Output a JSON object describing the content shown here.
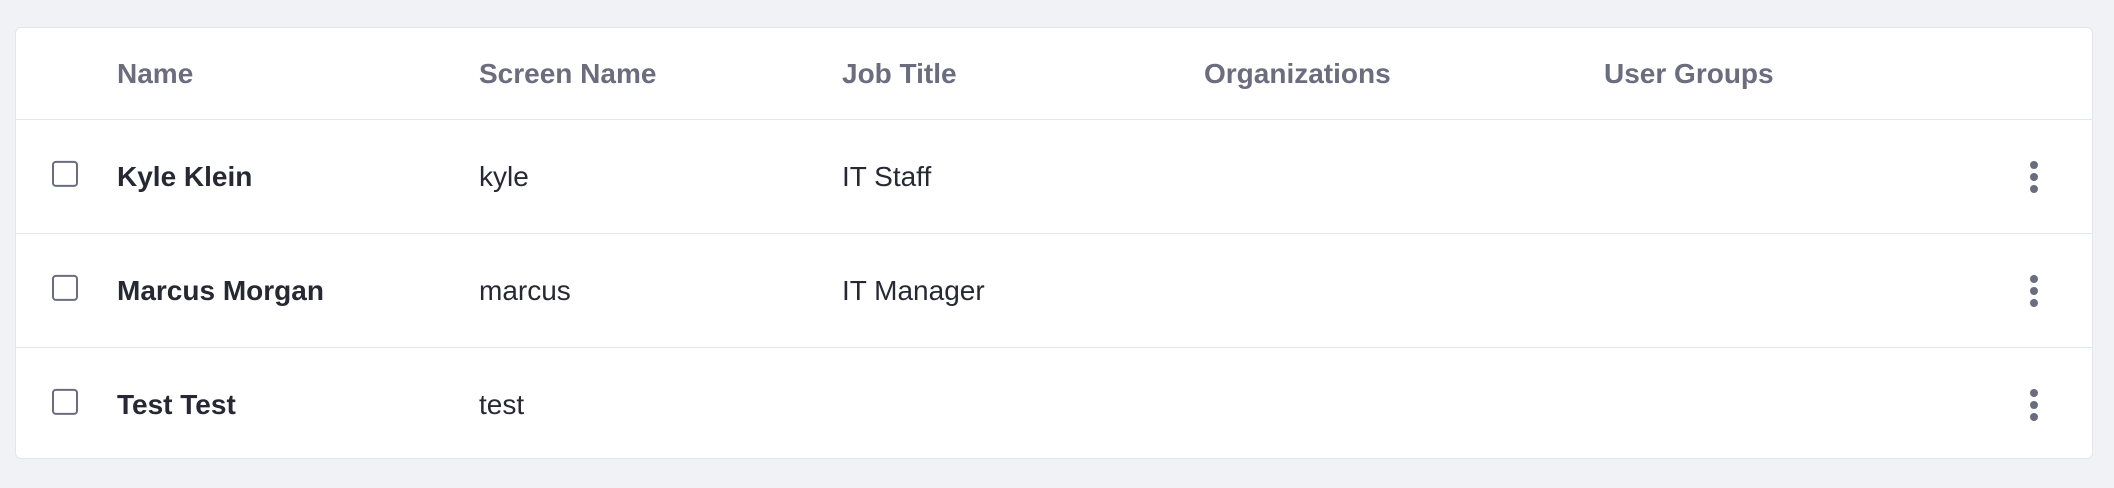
{
  "table": {
    "columns": {
      "name": "Name",
      "screen_name": "Screen Name",
      "job_title": "Job Title",
      "organizations": "Organizations",
      "user_groups": "User Groups"
    },
    "rows": [
      {
        "name": "Kyle Klein",
        "screen_name": "kyle",
        "job_title": "IT Staff",
        "organizations": "",
        "user_groups": ""
      },
      {
        "name": "Marcus Morgan",
        "screen_name": "marcus",
        "job_title": "IT Manager",
        "organizations": "",
        "user_groups": ""
      },
      {
        "name": "Test Test",
        "screen_name": "test",
        "job_title": "",
        "organizations": "",
        "user_groups": ""
      }
    ],
    "row_action_icon": "ellipsis-vertical-icon"
  },
  "colors": {
    "background": "#f1f2f5",
    "header_text": "#6b6c7e",
    "body_text": "#272833",
    "border": "#e4e6ea"
  }
}
